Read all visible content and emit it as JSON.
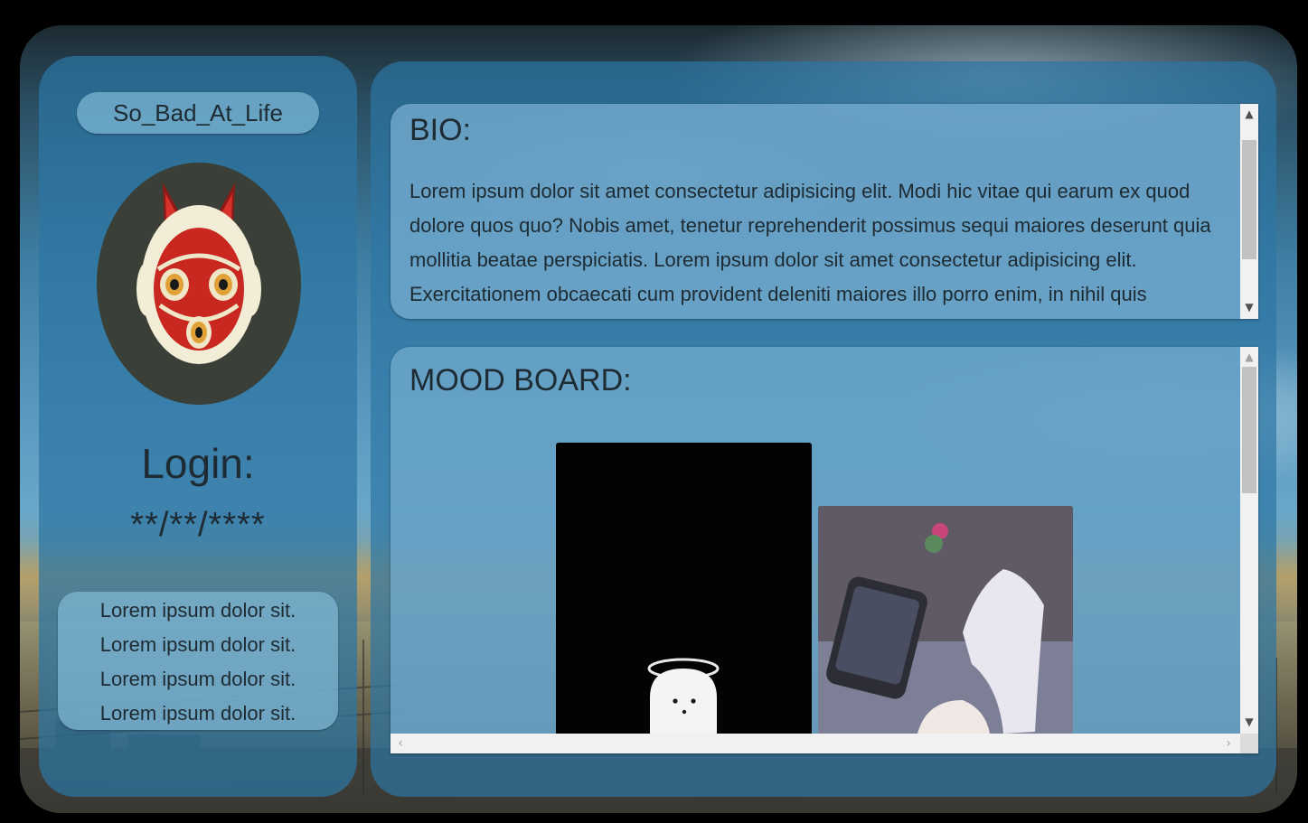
{
  "profile": {
    "username": "So_Bad_At_Life",
    "login_label": "Login:",
    "login_value": "**/**/****",
    "info_lines": [
      "Lorem ipsum dolor sit.",
      "Lorem ipsum dolor sit.",
      "Lorem ipsum dolor sit.",
      "Lorem ipsum dolor sit."
    ]
  },
  "bio": {
    "title": "BIO:",
    "text": "Lorem ipsum dolor sit amet consectetur adipisicing elit. Modi hic vitae qui earum ex quod dolore quos quo? Nobis amet, tenetur reprehenderit possimus sequi maiores deserunt quia mollitia beatae perspiciatis. Lorem ipsum dolor sit amet consectetur adipisicing elit. Exercitationem obcaecati cum provident deleniti maiores illo porro enim, in nihil quis"
  },
  "mood_board": {
    "title": "MOOD BOARD:",
    "images": [
      {
        "subject": "ghost-with-halo-image"
      },
      {
        "subject": "hand-and-phone-image"
      }
    ]
  },
  "icons": {
    "avatar": "princess-mononoke-mask-icon",
    "scroll_up": "chevron-up-icon",
    "scroll_down": "chevron-down-icon",
    "scroll_left": "chevron-left-icon",
    "scroll_right": "chevron-right-icon"
  },
  "colors": {
    "panel": "#2c76a4",
    "card": "#76acce",
    "text": "#1e2b33",
    "avatar_bg": "#3a3f37",
    "scrollbar_track": "#f1f1f1",
    "scrollbar_thumb": "#c1c1c1"
  }
}
